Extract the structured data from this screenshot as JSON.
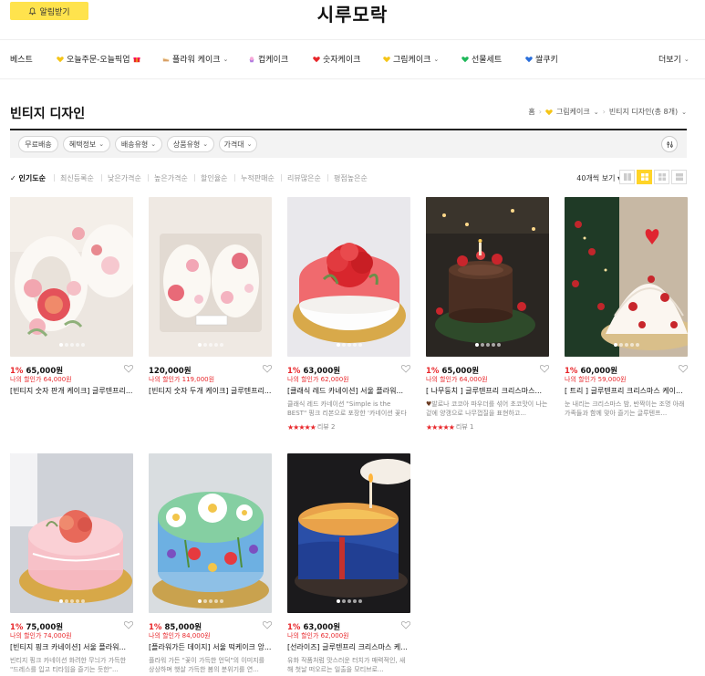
{
  "header": {
    "alert_label": "알림받기",
    "site_title": "시루모락"
  },
  "nav": {
    "items": [
      {
        "label": "베스트"
      },
      {
        "label": "오늘주문-오늘픽업"
      },
      {
        "label": "플라워 케이크"
      },
      {
        "label": "컵케이크"
      },
      {
        "label": "숫자케이크"
      },
      {
        "label": "그림케이크"
      },
      {
        "label": "선물세트"
      },
      {
        "label": "쌀쿠키"
      }
    ],
    "more_label": "더보기"
  },
  "page": {
    "title": "빈티지 디자인",
    "breadcrumb": {
      "home": "홈",
      "category": "그림케이크",
      "current": "빈티지 디자인(총 8개)"
    }
  },
  "filters": [
    "무료배송",
    "혜택정보",
    "배송유형",
    "상품유형",
    "가격대"
  ],
  "sort": {
    "items": [
      "인기도순",
      "최신등록순",
      "낮은가격순",
      "높은가격순",
      "할인율순",
      "누적판매순",
      "리뷰많은순",
      "평점높은순"
    ],
    "per_page": "40개씩 보기"
  },
  "colors": {
    "accent_yellow": "#ffe34d",
    "sale_red": "#e8272b"
  },
  "products": [
    {
      "rate": "1%",
      "price": "65,000원",
      "my_price": "나의 할인가 64,000원",
      "name": "[빈티지 숫자 판개 케이크] 글루텐프리...",
      "desc": "",
      "stars": "",
      "reviews": ""
    },
    {
      "rate": "",
      "price": "120,000원",
      "my_price": "나의 할인가 119,000원",
      "name": "[빈티지 숫자 두개 케이크] 글루텐프리...",
      "desc": "",
      "stars": "",
      "reviews": ""
    },
    {
      "rate": "1%",
      "price": "63,000원",
      "my_price": "나의 할인가 62,000원",
      "name": "[클래식 레드 카네이션] 서울 플라워...",
      "desc": "클래식 레드 카네이션 \"Simple is the BEST\" 핑크 리본으로 포장한 '카네이션 꽃다발'...",
      "stars": "★★★★★",
      "reviews": "리뷰 2"
    },
    {
      "rate": "1%",
      "price": "65,000원",
      "my_price": "나의 할인가 64,000원",
      "name": "[ 나무둥치 ] 글루텐프리 크리스마스...",
      "desc": "발로나 코코아 파우더를 섞어 초코맛이 나는 겉에 양갱으로 나무껍질을 표현하고...",
      "stars": "★★★★★",
      "reviews": "리뷰 1"
    },
    {
      "rate": "1%",
      "price": "60,000원",
      "my_price": "나의 할인가 59,000원",
      "name": "[ 트리 ] 글루텐프리 크리스마스 케이...",
      "desc": "눈 내리는 크리스마스 밤, 반짝이는 조명 아래 가족들과 함께 맞아 즐기는 글루텐프...",
      "stars": "",
      "reviews": ""
    },
    {
      "rate": "1%",
      "price": "75,000원",
      "my_price": "나의 할인가 74,000원",
      "name": "[빈티지 핑크 카네이션] 서울 플라워...",
      "desc": "빈티지 핑크 카네이션 화려한 무늬가 가득한 \"드레스를 입고 티타임을 즐기는 듯한\"...",
      "stars": "",
      "reviews": ""
    },
    {
      "rate": "1%",
      "price": "85,000원",
      "my_price": "나의 할인가 84,000원",
      "name": "[플라워가든 데이지] 서울 떡케이크 앙...",
      "desc": "플라워 가든 \"꽃이 가득한 언덕\"의 이미지를 상상하며 햇살 가득한 봄의 분위기를 연...",
      "stars": "",
      "reviews": ""
    },
    {
      "rate": "1%",
      "price": "63,000원",
      "my_price": "나의 할인가 62,000원",
      "name": "[선라이즈] 글루텐프리 크리스마스 케...",
      "desc": "유화 작품처럼 맛스러운 터치가 매력적인, 새해 첫날 떠오르는 일출을 모티브로...",
      "stars": "",
      "reviews": ""
    }
  ]
}
